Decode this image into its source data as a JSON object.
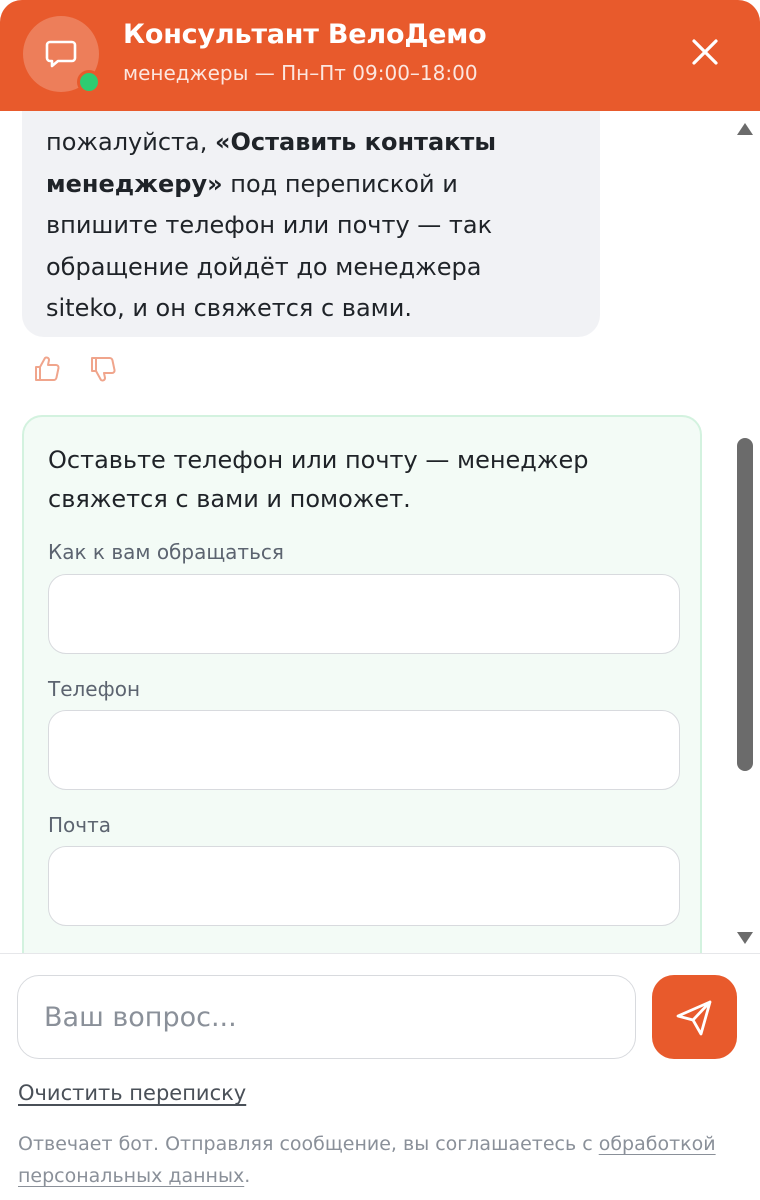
{
  "header": {
    "title": "Консультант ВелоДемо",
    "subtitle": "менеджеры — Пн–Пт 09:00–18:00",
    "avatar_icon": "chat-bubble-icon",
    "status": "online",
    "close_icon": "close-icon"
  },
  "messages": {
    "bot_message": {
      "line1_pre": "пожалуйста, ",
      "line1_bold": "«Оставить контакты",
      "line2_bold": "менеджеру»",
      "line2_post": " под перепиской и",
      "line3": "впишите телефон или почту — так",
      "line4": "обращение дойдёт до менеджера",
      "line5": "siteko, и он свяжется с вами.",
      "feedback_like_icon": "thumbs-up-icon",
      "feedback_dislike_icon": "thumbs-down-icon"
    },
    "lead_form": {
      "intro_line1": "Оставьте телефон или почту — менеджер",
      "intro_line2": "свяжется с вами и поможет.",
      "fields": [
        {
          "label": "Как к вам обращаться",
          "value": ""
        },
        {
          "label": "Телефон",
          "value": ""
        },
        {
          "label": "Почта",
          "value": ""
        }
      ]
    }
  },
  "composer": {
    "placeholder": "Ваш вопрос...",
    "value": "",
    "send_icon": "send-icon"
  },
  "footer": {
    "clear_label": "Очистить переписку",
    "disclaimer_text": "Отвечает бот. Отправляя сообщение, вы соглашаетесь с ",
    "disclaimer_link_1": "обработкой",
    "disclaimer_link_2": "персональных данных",
    "disclaimer_end": "."
  },
  "colors": {
    "accent": "#e85a2c",
    "online": "#2ecc71",
    "bubble_bg": "#f1f2f5",
    "form_bg": "#f3fbf6",
    "form_border": "#d3f2df"
  }
}
